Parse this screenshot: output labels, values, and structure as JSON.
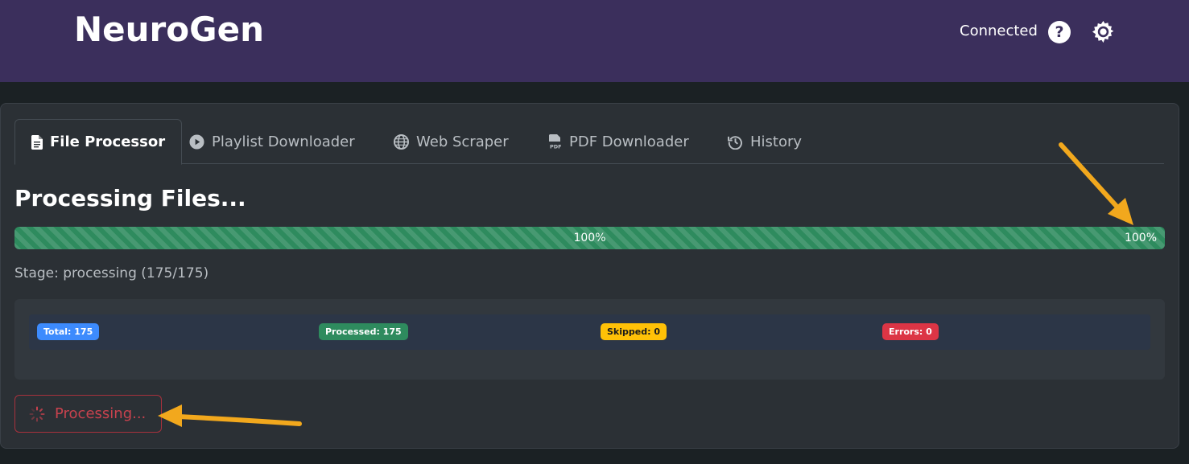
{
  "header": {
    "brand": "NeuroGen",
    "status": "Connected",
    "help_symbol": "?",
    "icons": [
      "help-circle-icon",
      "gear-icon"
    ]
  },
  "tabs": [
    {
      "label": "File Processor",
      "icon": "file-icon",
      "active": true
    },
    {
      "label": "Playlist Downloader",
      "icon": "play-circle-icon",
      "active": false
    },
    {
      "label": "Web Scraper",
      "icon": "globe-icon",
      "active": false
    },
    {
      "label": "PDF Downloader",
      "icon": "pdf-file-icon",
      "active": false
    },
    {
      "label": "History",
      "icon": "history-icon",
      "active": false
    }
  ],
  "progress": {
    "title": "Processing Files...",
    "percent": 100,
    "label_center": "100%",
    "label_right": "100%",
    "stage": "Stage: processing (175/175)"
  },
  "stats": {
    "total": "Total: 175",
    "processed": "Processed: 175",
    "skipped": "Skipped: 0",
    "errors": "Errors: 0"
  },
  "action": {
    "label": "Processing...",
    "icon": "spinner-icon"
  },
  "colors": {
    "navbar": "#3b2f5c",
    "progress": "#2e8b5e",
    "total": "#3d8bfd",
    "processed": "#2e8b5e",
    "skipped": "#ffc107",
    "errors": "#dc3545",
    "annotation_arrow": "#f2a81d"
  }
}
